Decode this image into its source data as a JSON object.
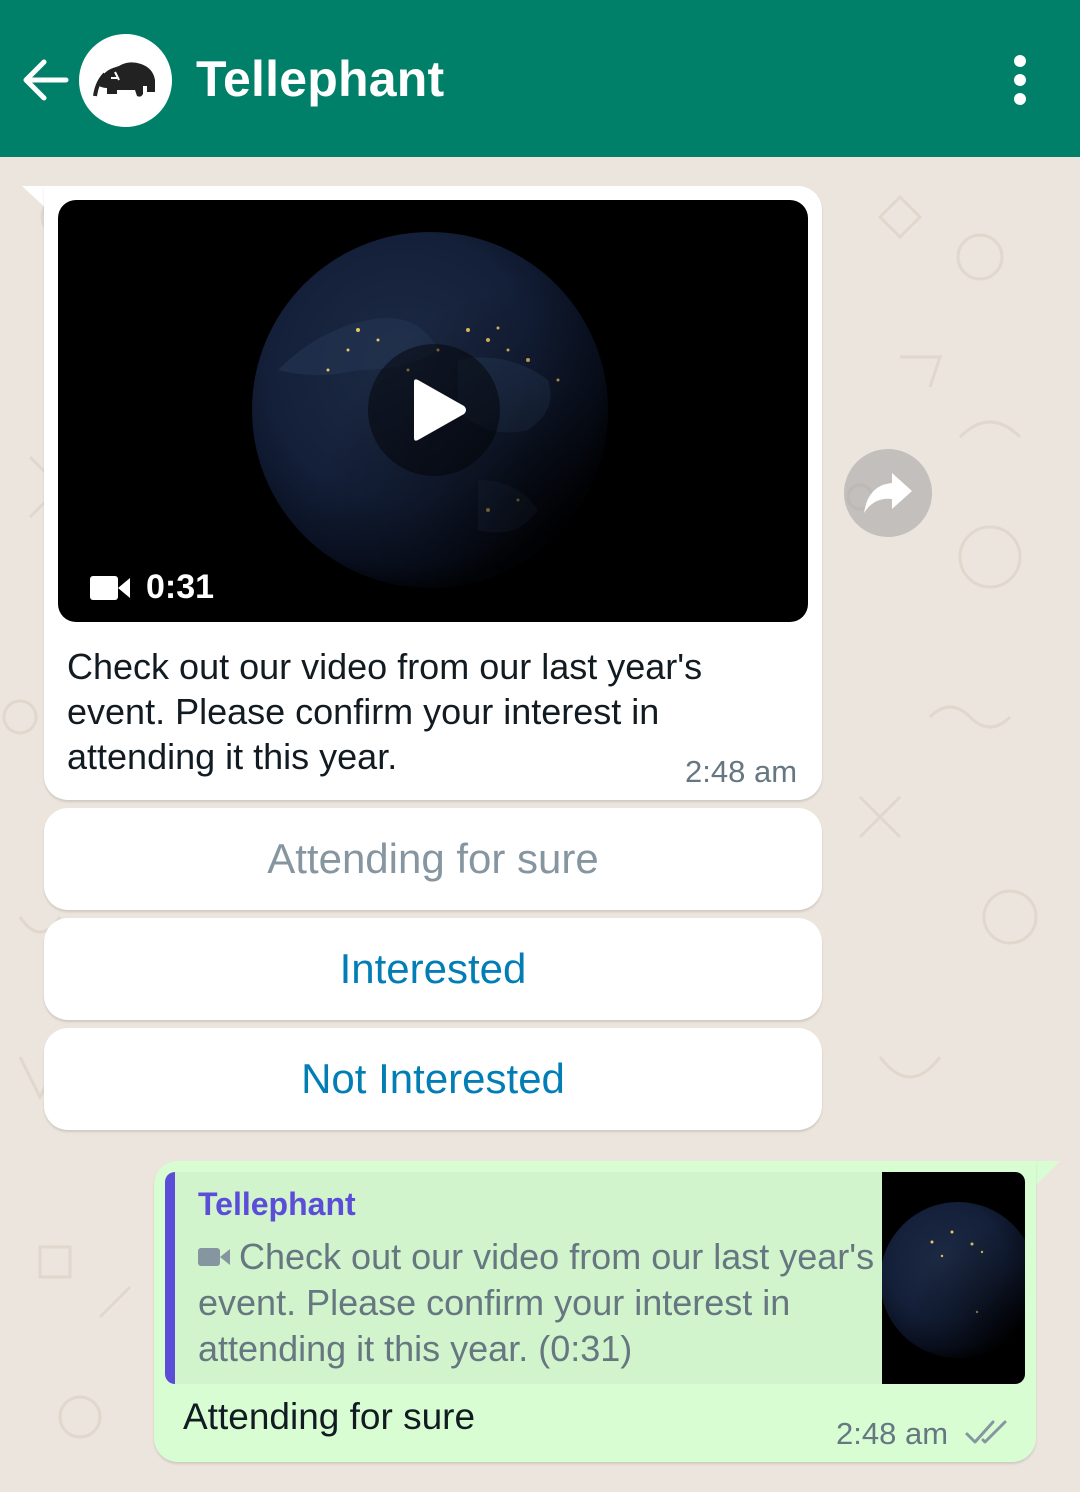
{
  "header": {
    "contact_name": "Tellephant",
    "back_icon": "arrow-left-icon",
    "menu_icon": "more-vertical-icon",
    "avatar_icon": "tellephant-logo-icon",
    "background_color": "#008069"
  },
  "incoming_message": {
    "video_duration": "0:31",
    "caption": "Check out our video from our last year's event. Please confirm your interest in attending it this year.",
    "time": "2:48 am"
  },
  "quick_replies": [
    {
      "label": "Attending for sure",
      "state": "selected"
    },
    {
      "label": "Interested",
      "state": "active"
    },
    {
      "label": "Not Interested",
      "state": "active"
    }
  ],
  "outgoing_message": {
    "quoted_author": "Tellephant",
    "quoted_text": "Check out our video from our last year's event. Please confirm your interest in attending it this year. (0:31)",
    "reply_text": "Attending for sure",
    "time": "2:48 am",
    "status": "read"
  },
  "colors": {
    "chat_background": "#ece5dd",
    "outgoing_bubble": "#d9fdd3",
    "button_text": "#027eb5",
    "quote_accent": "#5b4dd8"
  }
}
